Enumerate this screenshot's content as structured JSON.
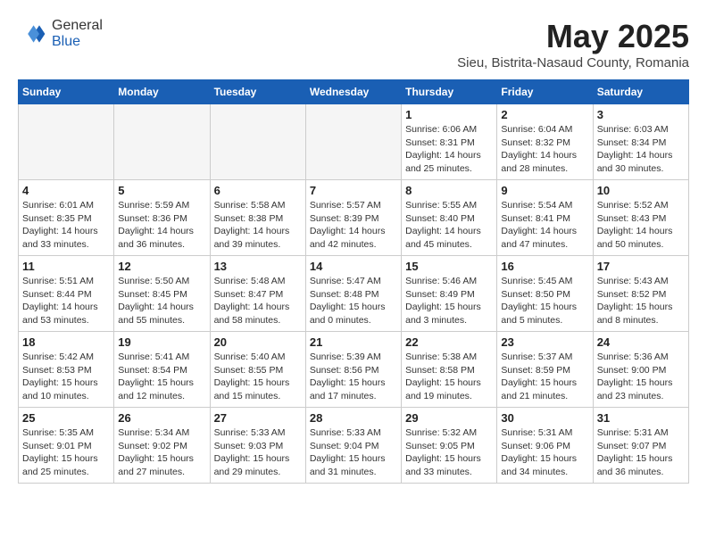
{
  "header": {
    "logo_general": "General",
    "logo_blue": "Blue",
    "month_title": "May 2025",
    "subtitle": "Sieu, Bistrita-Nasaud County, Romania"
  },
  "weekdays": [
    "Sunday",
    "Monday",
    "Tuesday",
    "Wednesday",
    "Thursday",
    "Friday",
    "Saturday"
  ],
  "weeks": [
    [
      {
        "day": "",
        "info": ""
      },
      {
        "day": "",
        "info": ""
      },
      {
        "day": "",
        "info": ""
      },
      {
        "day": "",
        "info": ""
      },
      {
        "day": "1",
        "info": "Sunrise: 6:06 AM\nSunset: 8:31 PM\nDaylight: 14 hours\nand 25 minutes."
      },
      {
        "day": "2",
        "info": "Sunrise: 6:04 AM\nSunset: 8:32 PM\nDaylight: 14 hours\nand 28 minutes."
      },
      {
        "day": "3",
        "info": "Sunrise: 6:03 AM\nSunset: 8:34 PM\nDaylight: 14 hours\nand 30 minutes."
      }
    ],
    [
      {
        "day": "4",
        "info": "Sunrise: 6:01 AM\nSunset: 8:35 PM\nDaylight: 14 hours\nand 33 minutes."
      },
      {
        "day": "5",
        "info": "Sunrise: 5:59 AM\nSunset: 8:36 PM\nDaylight: 14 hours\nand 36 minutes."
      },
      {
        "day": "6",
        "info": "Sunrise: 5:58 AM\nSunset: 8:38 PM\nDaylight: 14 hours\nand 39 minutes."
      },
      {
        "day": "7",
        "info": "Sunrise: 5:57 AM\nSunset: 8:39 PM\nDaylight: 14 hours\nand 42 minutes."
      },
      {
        "day": "8",
        "info": "Sunrise: 5:55 AM\nSunset: 8:40 PM\nDaylight: 14 hours\nand 45 minutes."
      },
      {
        "day": "9",
        "info": "Sunrise: 5:54 AM\nSunset: 8:41 PM\nDaylight: 14 hours\nand 47 minutes."
      },
      {
        "day": "10",
        "info": "Sunrise: 5:52 AM\nSunset: 8:43 PM\nDaylight: 14 hours\nand 50 minutes."
      }
    ],
    [
      {
        "day": "11",
        "info": "Sunrise: 5:51 AM\nSunset: 8:44 PM\nDaylight: 14 hours\nand 53 minutes."
      },
      {
        "day": "12",
        "info": "Sunrise: 5:50 AM\nSunset: 8:45 PM\nDaylight: 14 hours\nand 55 minutes."
      },
      {
        "day": "13",
        "info": "Sunrise: 5:48 AM\nSunset: 8:47 PM\nDaylight: 14 hours\nand 58 minutes."
      },
      {
        "day": "14",
        "info": "Sunrise: 5:47 AM\nSunset: 8:48 PM\nDaylight: 15 hours\nand 0 minutes."
      },
      {
        "day": "15",
        "info": "Sunrise: 5:46 AM\nSunset: 8:49 PM\nDaylight: 15 hours\nand 3 minutes."
      },
      {
        "day": "16",
        "info": "Sunrise: 5:45 AM\nSunset: 8:50 PM\nDaylight: 15 hours\nand 5 minutes."
      },
      {
        "day": "17",
        "info": "Sunrise: 5:43 AM\nSunset: 8:52 PM\nDaylight: 15 hours\nand 8 minutes."
      }
    ],
    [
      {
        "day": "18",
        "info": "Sunrise: 5:42 AM\nSunset: 8:53 PM\nDaylight: 15 hours\nand 10 minutes."
      },
      {
        "day": "19",
        "info": "Sunrise: 5:41 AM\nSunset: 8:54 PM\nDaylight: 15 hours\nand 12 minutes."
      },
      {
        "day": "20",
        "info": "Sunrise: 5:40 AM\nSunset: 8:55 PM\nDaylight: 15 hours\nand 15 minutes."
      },
      {
        "day": "21",
        "info": "Sunrise: 5:39 AM\nSunset: 8:56 PM\nDaylight: 15 hours\nand 17 minutes."
      },
      {
        "day": "22",
        "info": "Sunrise: 5:38 AM\nSunset: 8:58 PM\nDaylight: 15 hours\nand 19 minutes."
      },
      {
        "day": "23",
        "info": "Sunrise: 5:37 AM\nSunset: 8:59 PM\nDaylight: 15 hours\nand 21 minutes."
      },
      {
        "day": "24",
        "info": "Sunrise: 5:36 AM\nSunset: 9:00 PM\nDaylight: 15 hours\nand 23 minutes."
      }
    ],
    [
      {
        "day": "25",
        "info": "Sunrise: 5:35 AM\nSunset: 9:01 PM\nDaylight: 15 hours\nand 25 minutes."
      },
      {
        "day": "26",
        "info": "Sunrise: 5:34 AM\nSunset: 9:02 PM\nDaylight: 15 hours\nand 27 minutes."
      },
      {
        "day": "27",
        "info": "Sunrise: 5:33 AM\nSunset: 9:03 PM\nDaylight: 15 hours\nand 29 minutes."
      },
      {
        "day": "28",
        "info": "Sunrise: 5:33 AM\nSunset: 9:04 PM\nDaylight: 15 hours\nand 31 minutes."
      },
      {
        "day": "29",
        "info": "Sunrise: 5:32 AM\nSunset: 9:05 PM\nDaylight: 15 hours\nand 33 minutes."
      },
      {
        "day": "30",
        "info": "Sunrise: 5:31 AM\nSunset: 9:06 PM\nDaylight: 15 hours\nand 34 minutes."
      },
      {
        "day": "31",
        "info": "Sunrise: 5:31 AM\nSunset: 9:07 PM\nDaylight: 15 hours\nand 36 minutes."
      }
    ]
  ]
}
